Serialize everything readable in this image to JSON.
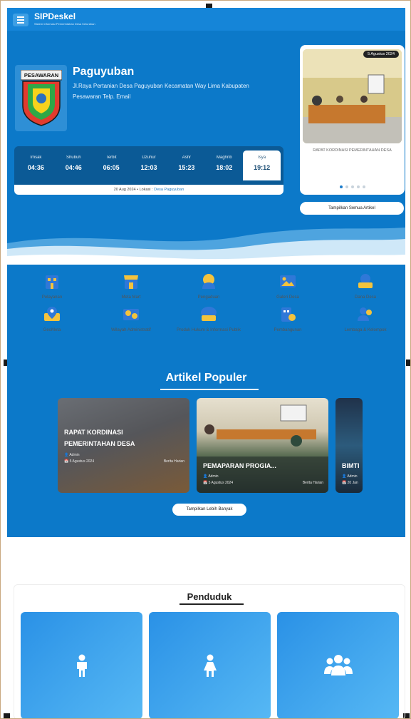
{
  "header": {
    "app_name": "SIPDeskel",
    "app_subtitle": "Sistem Informasi Pemerintahan Desa Kelurahan"
  },
  "logo": {
    "text": "PESAWARAN"
  },
  "village": {
    "name": "Paguyuban",
    "address": "Jl.Raya Pertanian Desa Paguyuban Kecamatan Way Lima Kabupaten Pesawaran Telp. Email"
  },
  "prayer": {
    "times": [
      {
        "name": "Imsak",
        "time": "04:36"
      },
      {
        "name": "Shubuh",
        "time": "04:46"
      },
      {
        "name": "Terbit",
        "time": "06:05"
      },
      {
        "name": "Dzuhur",
        "time": "12:03"
      },
      {
        "name": "Ashr",
        "time": "15:23"
      },
      {
        "name": "Maghrib",
        "time": "18:02"
      },
      {
        "name": "Isya",
        "time": "19:12"
      }
    ],
    "active_index": 6,
    "date": "20 Aug 2024",
    "location_label": "Lokasi :",
    "location": "Desa Paguyuban"
  },
  "slider": {
    "date": "5 Agustus 2024",
    "caption": "RAPAT KORDINASI PEMERINTAHAN DESA",
    "dots": 5,
    "active_dot": 0,
    "all_label": "Tampilkan Semua Artikel"
  },
  "menu": [
    {
      "label": "Pelayanan",
      "icon": "building-icon"
    },
    {
      "label": "Meta Mart",
      "icon": "store-icon"
    },
    {
      "label": "Pengaduan",
      "icon": "complaint-icon"
    },
    {
      "label": "Galeri Desa",
      "icon": "gallery-icon"
    },
    {
      "label": "Dana Desa",
      "icon": "fund-icon"
    },
    {
      "label": "GeoMeta",
      "icon": "map-pin-icon"
    },
    {
      "label": "Wilayah Administratif",
      "icon": "region-icon"
    },
    {
      "label": "Produk Hukum & Informasi Publik",
      "icon": "law-icon"
    },
    {
      "label": "Pembangunan",
      "icon": "construction-icon"
    },
    {
      "label": "Lembaga & Kelompok",
      "icon": "group-icon"
    }
  ],
  "popular": {
    "title": "Artikel Populer",
    "articles": [
      {
        "title": "RAPAT KORDINASI PEMERINTAHAN DESA",
        "author": "Admin",
        "date": "5 Agustus 2024",
        "category": "Berita Harian"
      },
      {
        "title": "PEMAPARAN PROGIA...",
        "author": "Admin",
        "date": "5 Agustus 2024",
        "category": "Berita Harian"
      },
      {
        "title": "BIMTI",
        "author": "Admin",
        "date": "20 Jan",
        "category": ""
      }
    ],
    "more_label": "Tampilkan Lebih Banyak"
  },
  "population": {
    "title": "Penduduk",
    "boxes": [
      {
        "icon": "male-icon"
      },
      {
        "icon": "female-icon"
      },
      {
        "icon": "people-icon"
      }
    ]
  },
  "colors": {
    "primary": "#0c79c9",
    "topbar": "#1585d8",
    "dark": "#0b5a96"
  }
}
